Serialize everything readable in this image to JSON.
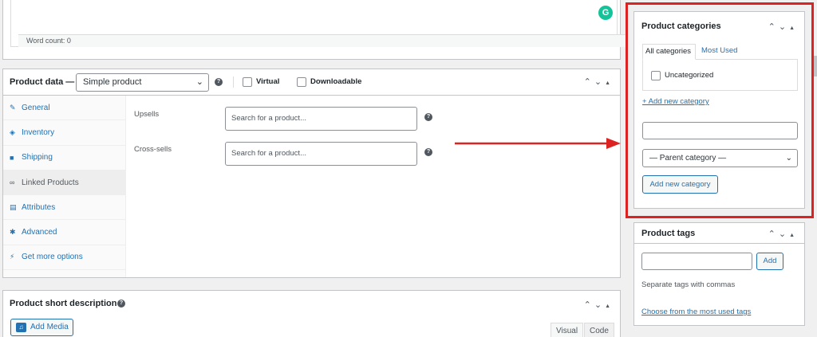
{
  "editor": {
    "word_count": "Word count: 0",
    "grammarly_badge": "G"
  },
  "product_data": {
    "title": "Product data —",
    "product_type": "Simple product",
    "virtual_label": "Virtual",
    "downloadable_label": "Downloadable",
    "tabs": [
      {
        "label": "General",
        "icon": "wrench-icon",
        "glyph": "✎"
      },
      {
        "label": "Inventory",
        "icon": "tag-icon",
        "glyph": "◈"
      },
      {
        "label": "Shipping",
        "icon": "truck-icon",
        "glyph": "■"
      },
      {
        "label": "Linked Products",
        "icon": "link-icon",
        "glyph": "∞"
      },
      {
        "label": "Attributes",
        "icon": "list-icon",
        "glyph": "▤"
      },
      {
        "label": "Advanced",
        "icon": "gear-icon",
        "glyph": "✱"
      },
      {
        "label": "Get more options",
        "icon": "plugin-icon",
        "glyph": "⚡"
      }
    ],
    "active_tab": "Linked Products",
    "upsells_label": "Upsells",
    "upsells_placeholder": "Search for a product...",
    "crosssells_label": "Cross-sells",
    "crosssells_placeholder": "Search for a product..."
  },
  "short_description": {
    "title": "Product short description",
    "add_media": "Add Media",
    "visual_tab": "Visual",
    "code_tab": "Code"
  },
  "product_categories": {
    "title": "Product categories",
    "tab_all": "All categories",
    "tab_most_used": "Most Used",
    "categories": [
      "Uncategorized"
    ],
    "add_new_link": "+ Add new category",
    "parent_select": "— Parent category —",
    "add_button": "Add new category"
  },
  "product_tags": {
    "title": "Product tags",
    "add_button": "Add",
    "hint": "Separate tags with commas",
    "choose_link": "Choose from the most used tags"
  },
  "colors": {
    "accent": "#2271b1",
    "highlight": "#dd2222",
    "grammarly": "#15c39a"
  }
}
